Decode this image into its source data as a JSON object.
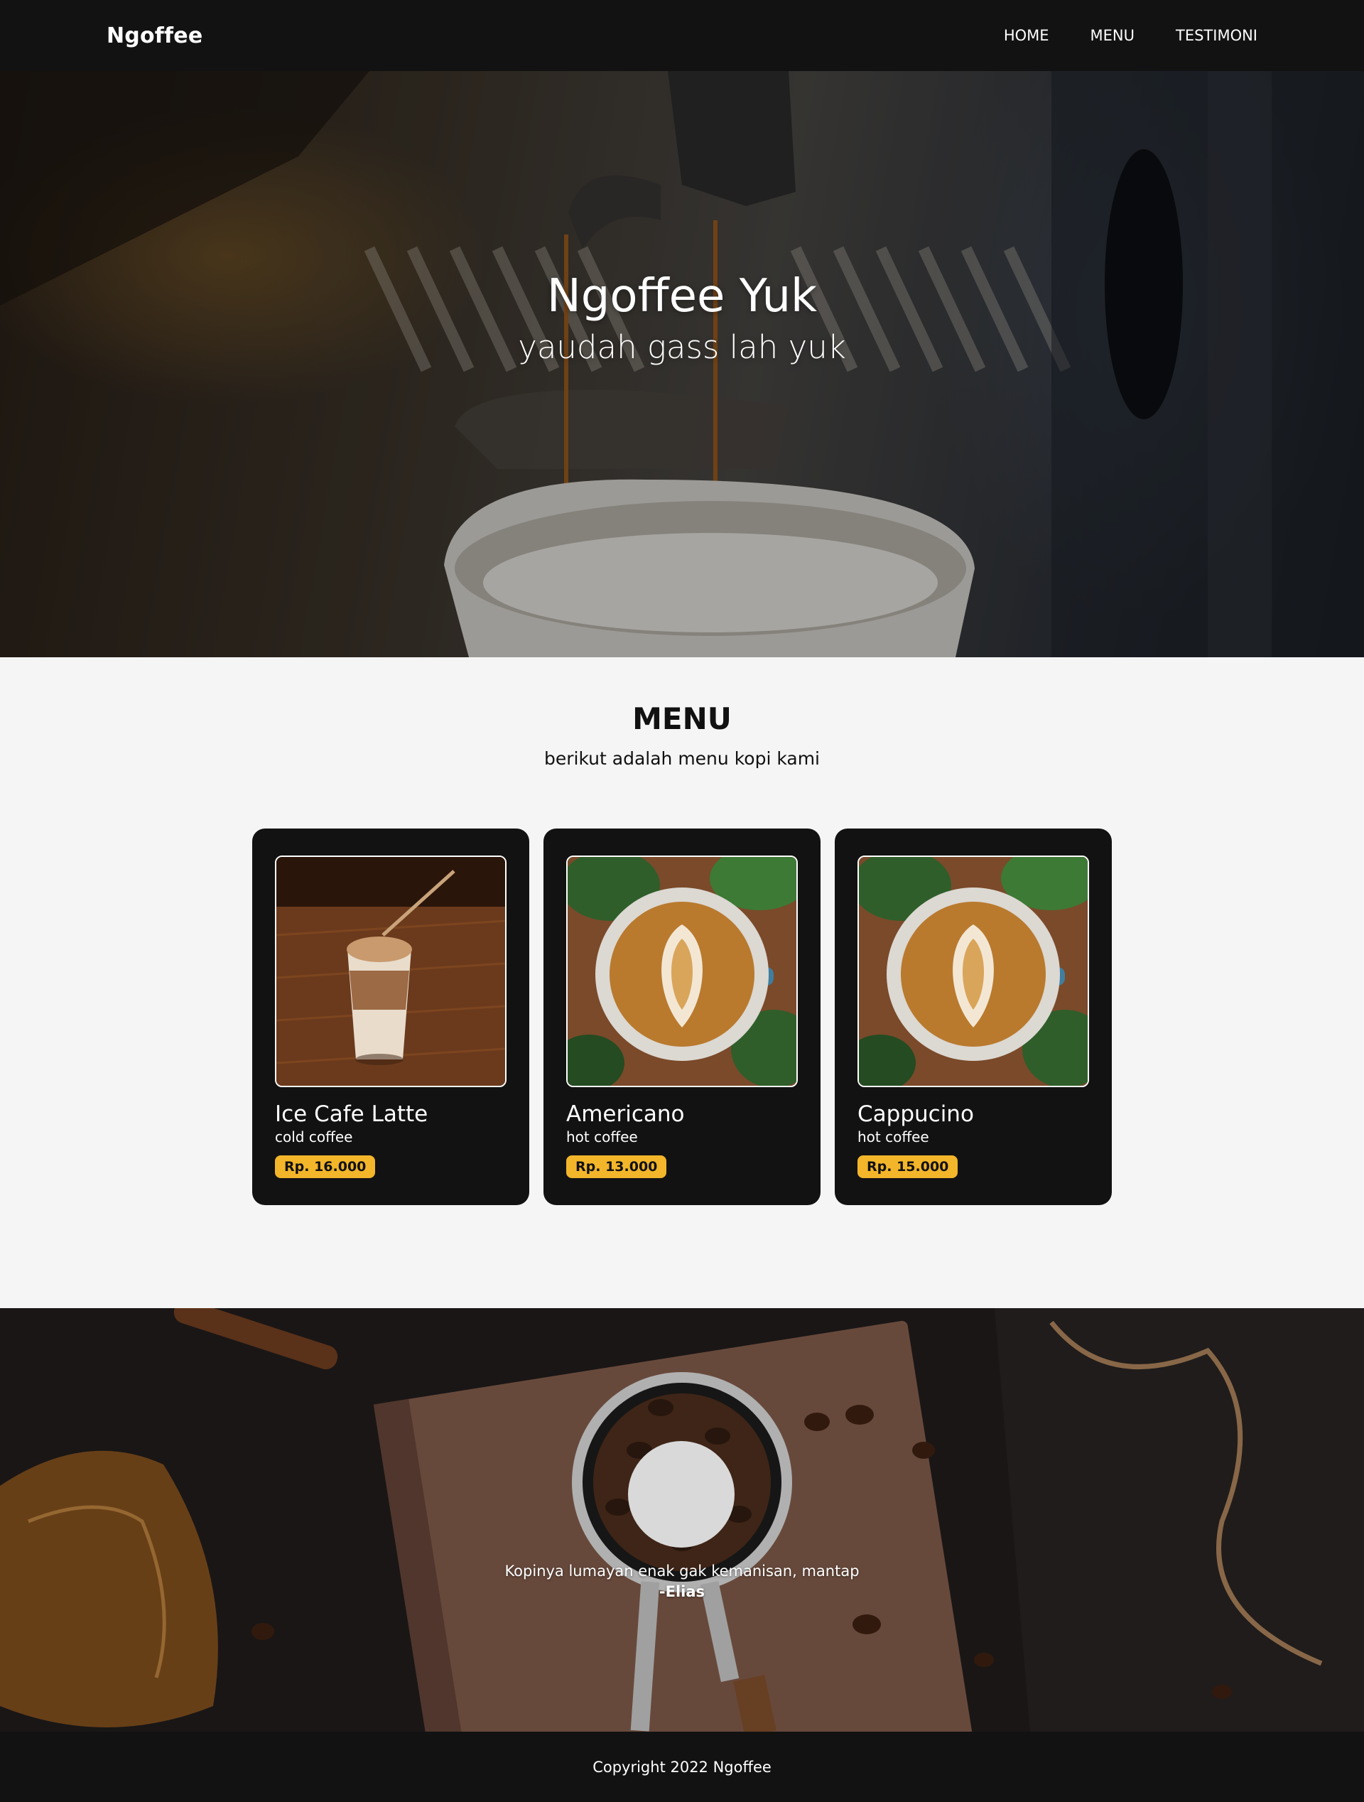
{
  "navbar": {
    "brand": "Ngoffee",
    "links": [
      {
        "label": "HOME"
      },
      {
        "label": "MENU"
      },
      {
        "label": "TESTIMONI"
      }
    ]
  },
  "hero": {
    "title": "Ngoffee Yuk",
    "subtitle": "yaudah gass lah yuk"
  },
  "menu": {
    "heading": "MENU",
    "subheading": "berikut adalah menu kopi kami",
    "items": [
      {
        "name": "Ice Cafe Latte",
        "description": "cold coffee",
        "price": "Rp. 16.000"
      },
      {
        "name": "Americano",
        "description": "hot coffee",
        "price": "Rp. 13.000"
      },
      {
        "name": "Cappucino",
        "description": "hot coffee",
        "price": "Rp. 15.000"
      }
    ]
  },
  "testimoni": {
    "quote": "Kopinya lumayan enak gak kemanisan, mantap",
    "author": "-Elias"
  },
  "footer": {
    "copyright": "Copyright 2022 Ngoffee"
  },
  "colors": {
    "dark": "#121212",
    "accent": "#f3b52a",
    "background": "#f5f5f5"
  }
}
